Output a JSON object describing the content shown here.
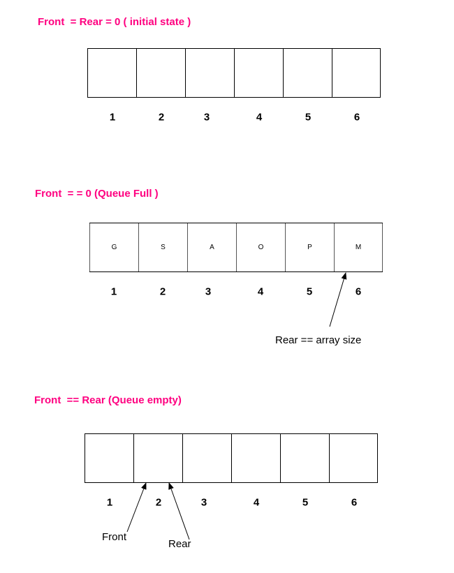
{
  "diagrams": [
    {
      "title": "Front  = Rear = 0 ( initial state )",
      "cells": [
        "",
        "",
        "",
        "",
        "",
        ""
      ],
      "indices": [
        "1",
        "2",
        "3",
        "4",
        "5",
        "6"
      ]
    },
    {
      "title": "Front  = = 0 (Queue Full )",
      "cells": [
        "G",
        "S",
        "A",
        "O",
        "P",
        "M"
      ],
      "indices": [
        "1",
        "2",
        "3",
        "4",
        "5",
        "6"
      ],
      "annotations": [
        {
          "label": "Rear == array size",
          "points_to_index": 6
        }
      ]
    },
    {
      "title": "Front  == Rear (Queue empty)",
      "cells": [
        "",
        "",
        "",
        "",
        "",
        ""
      ],
      "indices": [
        "1",
        "2",
        "3",
        "4",
        "5",
        "6"
      ],
      "annotations": [
        {
          "label": "Front",
          "points_to_index": 2
        },
        {
          "label": "Rear",
          "points_to_index": 2
        }
      ]
    }
  ],
  "colors": {
    "title": "#ff0080",
    "lines": "#000000",
    "background": "#ffffff"
  }
}
